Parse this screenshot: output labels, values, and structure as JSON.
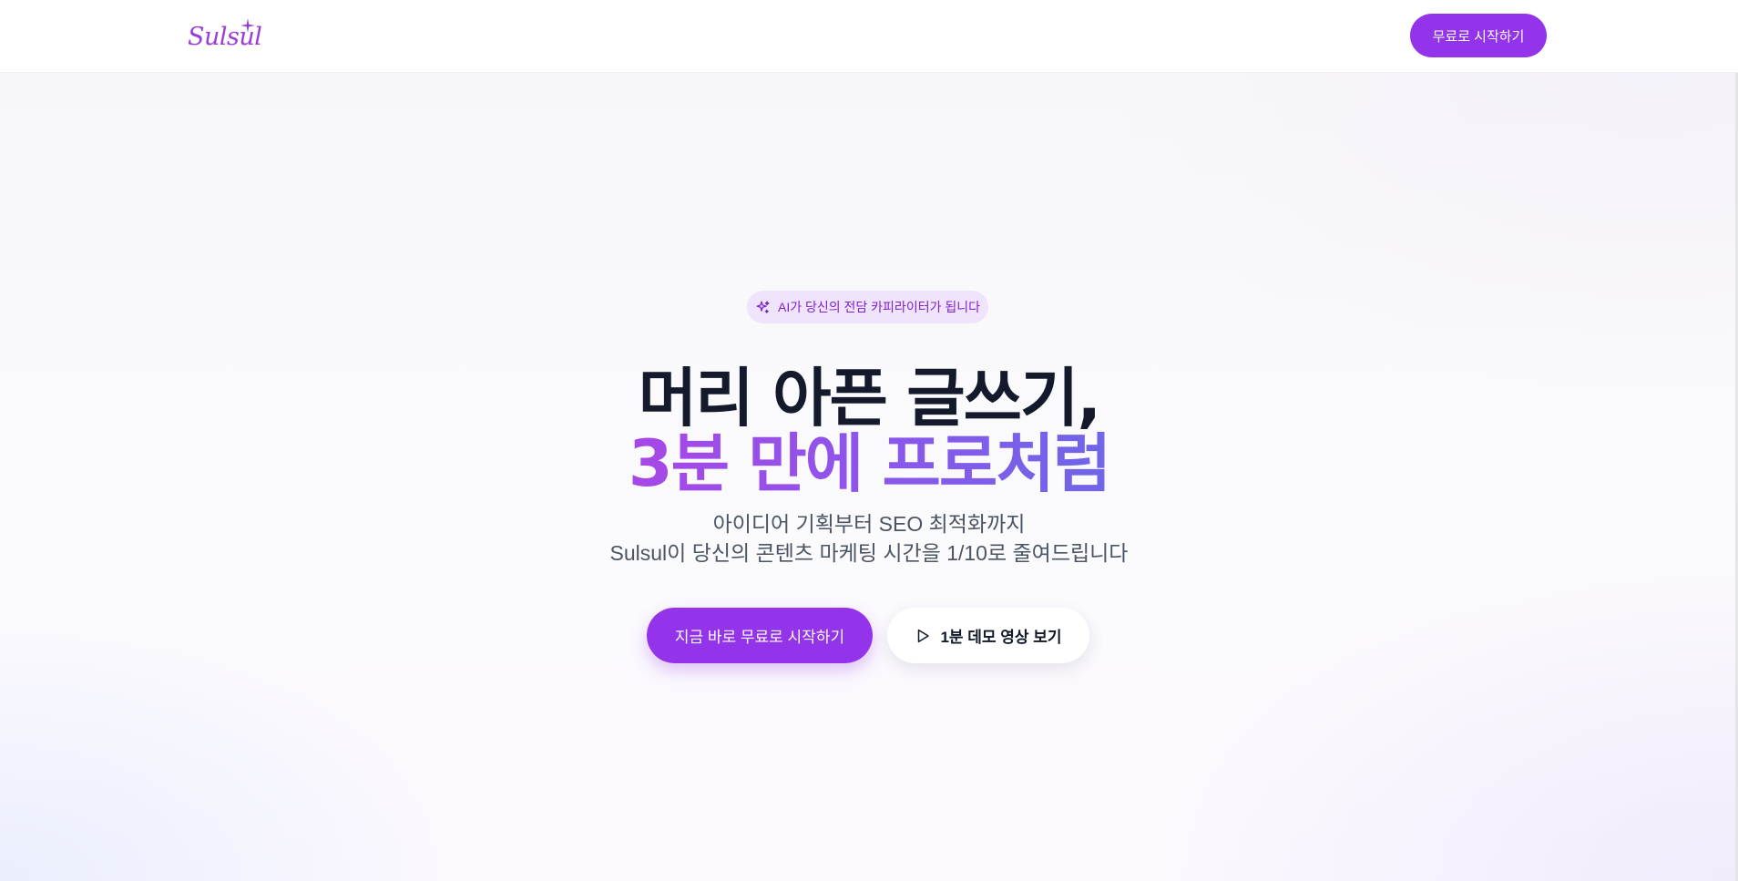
{
  "header": {
    "logo_text": "Sulsul",
    "cta_label": "무료로 시작하기"
  },
  "hero": {
    "badge_icon": "sparkles-icon",
    "badge_text": "AI가 당신의 전담 카피라이터가 됩니다",
    "title_line1": "머리 아픈 글쓰기,",
    "title_line2": "3분 만에 프로처럼",
    "subtitle_line1": "아이디어 기획부터 SEO 최적화까지",
    "subtitle_line2": "Sulsul이 당신의 콘텐츠 마케팅 시간을 1/10로 줄여드립니다",
    "primary_cta": "지금 바로 무료로 시작하기",
    "secondary_cta": "1분 데모 영상 보기",
    "secondary_icon": "play-icon"
  },
  "colors": {
    "brand": "#9333ea",
    "badge_bg": "#f0e4fc",
    "title_dark": "#141a2c",
    "gradient_start": "#a747e6",
    "gradient_end": "#6e66e8",
    "body_text": "#4b5563"
  }
}
